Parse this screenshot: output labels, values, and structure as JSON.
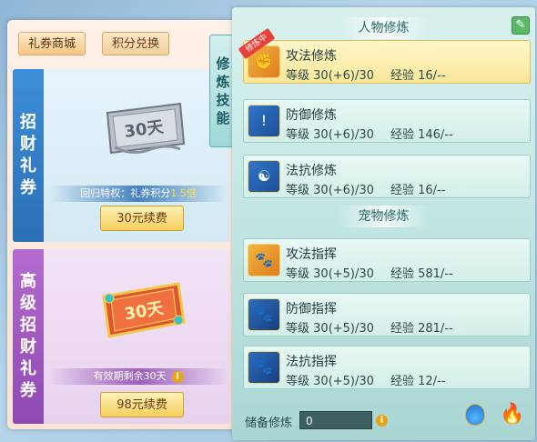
{
  "left": {
    "tabs": [
      {
        "label": "礼券商城"
      },
      {
        "label": "积分兑换"
      }
    ],
    "cards": [
      {
        "side_chars": [
          "招",
          "财",
          "礼",
          "券"
        ],
        "ticket_text": "30天",
        "info_prefix": "回归特权：礼券积分",
        "info_highlight": "1.5倍",
        "button": "30元续费"
      },
      {
        "side_chars": [
          "高",
          "级",
          "招",
          "财",
          "礼",
          "券"
        ],
        "ticket_text": "30天",
        "info_prefix": "有效期剩余30天",
        "info_icon": "i",
        "button": "98元续费"
      }
    ]
  },
  "vtab": {
    "chars": [
      "修",
      "炼",
      "技",
      "能"
    ]
  },
  "right": {
    "edit_icon": "edit-icon",
    "sections": [
      {
        "title": "人物修炼",
        "skills": [
          {
            "name": "攻法修炼",
            "level_label": "等级",
            "level": "30(+6)/30",
            "exp_label": "经验",
            "exp": "16/--",
            "badge": "修炼中",
            "icon": "sword-fist-icon"
          },
          {
            "name": "防御修炼",
            "level_label": "等级",
            "level": "30(+6)/30",
            "exp_label": "经验",
            "exp": "146/--",
            "icon": "shield-icon"
          },
          {
            "name": "法抗修炼",
            "level_label": "等级",
            "level": "30(+6)/30",
            "exp_label": "经验",
            "exp": "16/--",
            "icon": "taiji-shield-icon"
          }
        ]
      },
      {
        "title": "宠物修炼",
        "skills": [
          {
            "name": "攻法指挥",
            "level_label": "等级",
            "level": "30(+5)/30",
            "exp_label": "经验",
            "exp": "581/--",
            "icon": "paw-attack-icon"
          },
          {
            "name": "防御指挥",
            "level_label": "等级",
            "level": "30(+5)/30",
            "exp_label": "经验",
            "exp": "281/--",
            "icon": "paw-shield-icon"
          },
          {
            "name": "法抗指挥",
            "level_label": "等级",
            "level": "30(+5)/30",
            "exp_label": "经验",
            "exp": "12/--",
            "icon": "paw-magic-shield-icon"
          }
        ]
      }
    ],
    "reserve": {
      "label": "储备修炼",
      "value": "0",
      "info": "i"
    }
  }
}
